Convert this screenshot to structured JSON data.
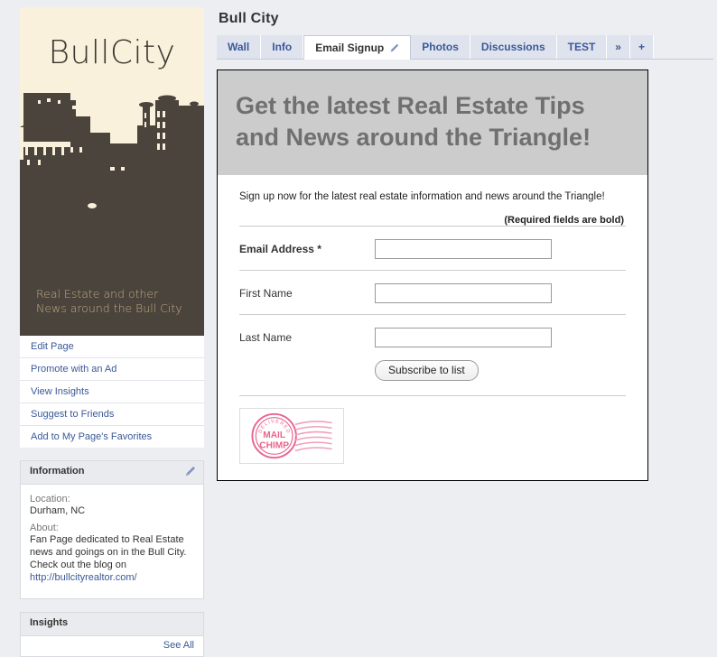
{
  "page": {
    "title": "Bull City"
  },
  "profile": {
    "logo_text": "BullCity",
    "caption_line1": "Real Estate and other",
    "caption_line2": "News around the Bull City",
    "bg_color": "#f9f1dc",
    "skyline_color": "#4a443c",
    "caption_text_color": "#c3a97f"
  },
  "admin_links": [
    {
      "label": "Edit Page"
    },
    {
      "label": "Promote with an Ad"
    },
    {
      "label": "View Insights"
    },
    {
      "label": "Suggest to Friends"
    },
    {
      "label": "Add to My Page's Favorites"
    }
  ],
  "information": {
    "header": "Information",
    "location_label": "Location:",
    "location_value": "Durham, NC",
    "about_label": "About:",
    "about_value": "Fan Page dedicated to Real Estate news and goings on in the Bull City. Check out the blog on ",
    "about_link": "http://bullcityrealtor.com/"
  },
  "insights": {
    "header": "Insights",
    "see_all": "See All"
  },
  "tabs": [
    {
      "label": "Wall",
      "active": false
    },
    {
      "label": "Info",
      "active": false
    },
    {
      "label": "Email Signup",
      "active": true
    },
    {
      "label": "Photos",
      "active": false
    },
    {
      "label": "Discussions",
      "active": false
    },
    {
      "label": "TEST",
      "active": false
    }
  ],
  "tab_controls": {
    "more_label": "»",
    "add_label": "+"
  },
  "signup": {
    "headline": "Get the latest Real Estate Tips and News around the Triangle!",
    "intro": "Sign up now for the latest real estate information and news around the Triangle!",
    "required_note": "(Required fields are bold)",
    "fields": [
      {
        "label": "Email Address *",
        "required": true,
        "value": "",
        "placeholder": ""
      },
      {
        "label": "First Name",
        "required": false,
        "value": "",
        "placeholder": ""
      },
      {
        "label": "Last Name",
        "required": false,
        "value": "",
        "placeholder": ""
      }
    ],
    "submit_label": "Subscribe to list",
    "badge": {
      "top_text": "DELIVERED BY",
      "line1": "MAIL",
      "line2": "CHIMP",
      "color": "#e8658f"
    }
  },
  "colors": {
    "page_bg": "#edeef2",
    "link_blue": "#3b5998",
    "tab_bg": "#dfe3ee",
    "promo_bg": "#cccccc",
    "promo_text": "#707070"
  }
}
